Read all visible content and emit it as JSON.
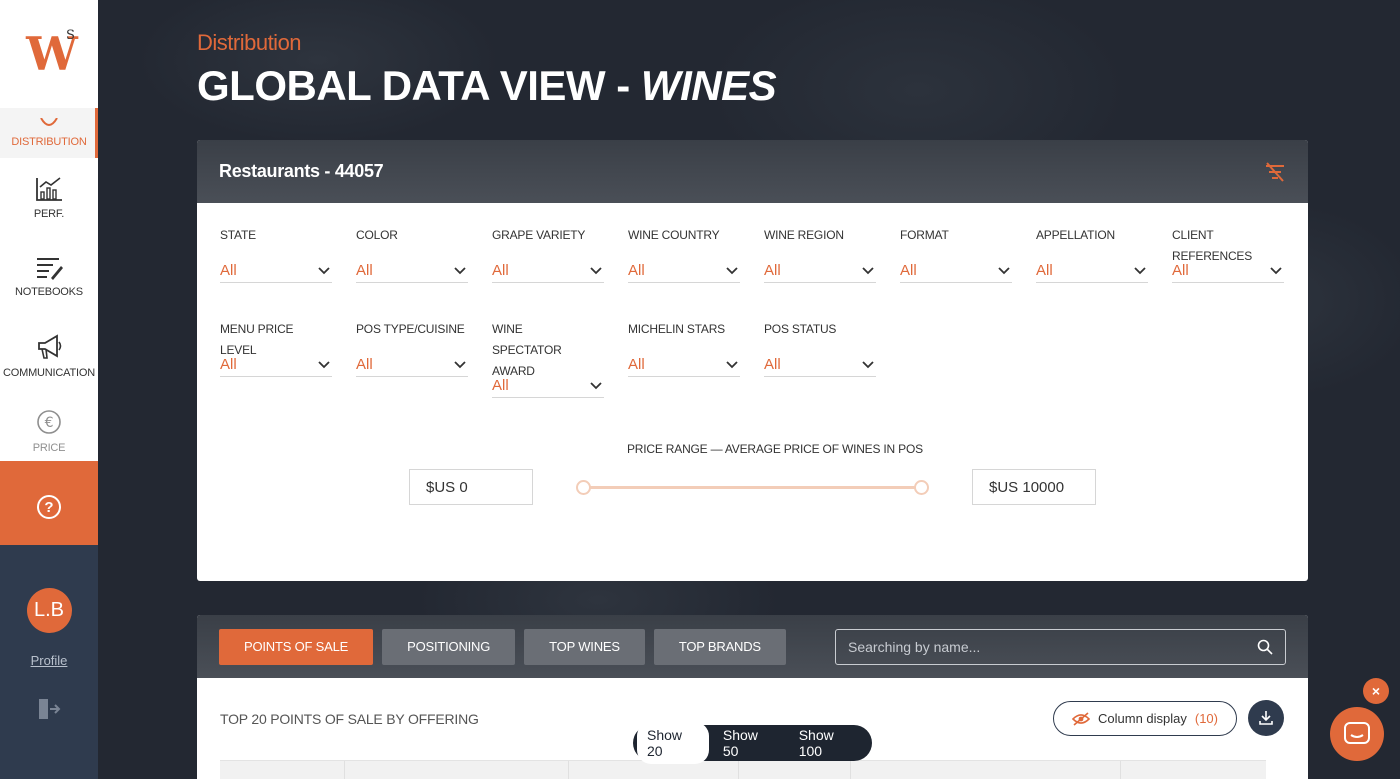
{
  "sidebar": {
    "logo": {
      "main": "W",
      "sup": "S"
    },
    "items": [
      {
        "label": "DISTRIBUTION",
        "icon": "map-pin-icon"
      },
      {
        "label": "PERF.",
        "icon": "chart-icon"
      },
      {
        "label": "NOTEBOOKS",
        "icon": "notebook-icon"
      },
      {
        "label": "COMMUNICATION",
        "icon": "megaphone-icon"
      },
      {
        "label": "PRICE",
        "icon": "euro-icon"
      }
    ],
    "help_icon": "question-icon",
    "user": {
      "initials": "L.B",
      "profile_label": "Profile",
      "logout_icon": "logout-icon"
    }
  },
  "header": {
    "breadcrumb": "Distribution",
    "title_main": "GLOBAL DATA VIEW - ",
    "title_em": "WINES"
  },
  "filters_panel": {
    "title": "Restaurants - 44057",
    "clear_icon": "clear-filter-icon",
    "filters": [
      {
        "label": "STATE",
        "value": "All"
      },
      {
        "label": "COLOR",
        "value": "All"
      },
      {
        "label": "GRAPE VARIETY",
        "value": "All"
      },
      {
        "label": "WINE COUNTRY",
        "value": "All"
      },
      {
        "label": "WINE REGION",
        "value": "All"
      },
      {
        "label": "FORMAT",
        "value": "All"
      },
      {
        "label": "APPELLATION",
        "value": "All"
      },
      {
        "label": "CLIENT REFERENCES",
        "value": "All"
      },
      {
        "label": "MENU PRICE LEVEL",
        "value": "All"
      },
      {
        "label": "POS TYPE/CUISINE",
        "value": "All"
      },
      {
        "label": "WINE SPECTATOR AWARD",
        "value": "All"
      },
      {
        "label": "MICHELIN STARS",
        "value": "All"
      },
      {
        "label": "POS STATUS",
        "value": "All"
      }
    ],
    "price_range": {
      "label": "PRICE RANGE — AVERAGE PRICE OF WINES IN POS",
      "min_value": "$US 0",
      "max_value": "$US 10000"
    }
  },
  "results_panel": {
    "tabs": [
      "POINTS OF SALE",
      "POSITIONING",
      "TOP WINES",
      "TOP BRANDS"
    ],
    "active_tab": "POINTS OF SALE",
    "search_placeholder": "Searching by name...",
    "section_title": "TOP 20 POINTS OF SALE BY OFFERING",
    "column_display_label": "Column display",
    "column_display_count": "(10)",
    "download_icon": "download-icon"
  },
  "show_toggle": {
    "options": [
      "Show 20",
      "Show 50",
      "Show 100"
    ],
    "selected": "Show 20"
  },
  "chat": {
    "close_label": "×",
    "icon": "chat-icon"
  },
  "colors": {
    "accent": "#e0693a",
    "navy": "#2f3b4e",
    "dark_bg": "#232832"
  }
}
